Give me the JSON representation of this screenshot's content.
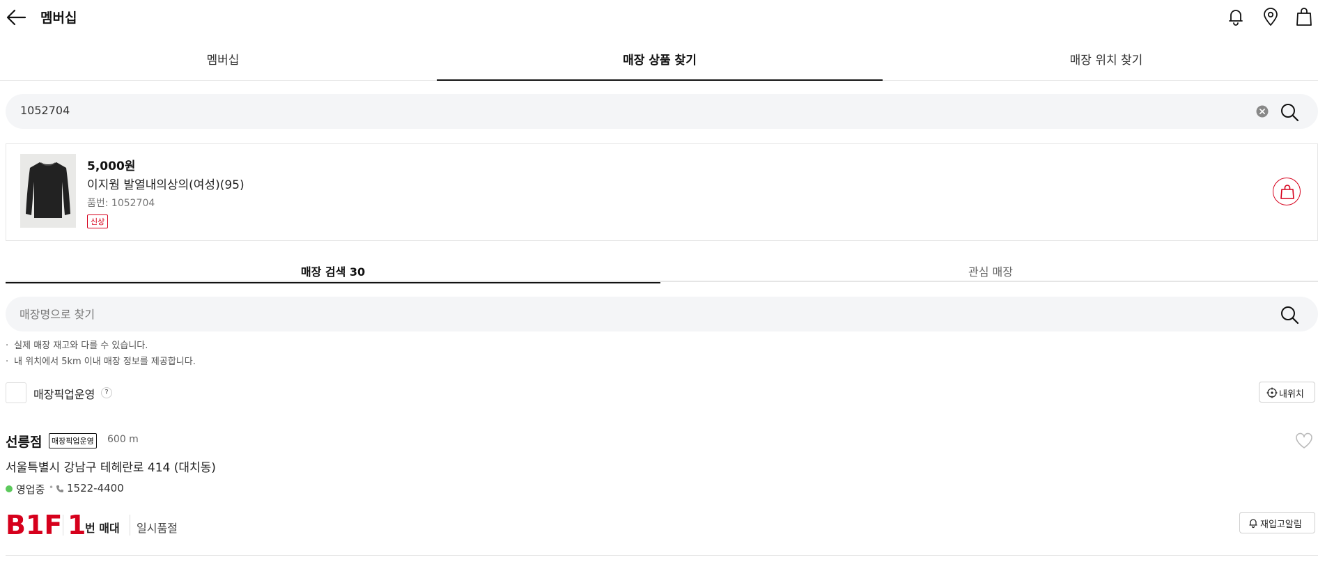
{
  "header": {
    "title": "멤버십",
    "icons": [
      "back-arrow-icon",
      "bell-icon",
      "location-pin-icon",
      "shopping-bag-icon"
    ]
  },
  "tabs": [
    {
      "label": "멤버십",
      "active": false
    },
    {
      "label": "매장 상품 찾기",
      "active": true
    },
    {
      "label": "매장 위치 찾기",
      "active": false
    }
  ],
  "search": {
    "value": "1052704"
  },
  "product": {
    "price": "5,000원",
    "name": "이지웜 발열내의상의(여성)(95)",
    "code": "품번: 1052704",
    "badge": "신상"
  },
  "subtabs": [
    {
      "label": "매장 검색 30",
      "active": true
    },
    {
      "label": "관심 매장",
      "active": false
    }
  ],
  "store_search": {
    "placeholder": "매장명으로 찾기"
  },
  "notices": [
    "실제 매장 재고와 다를 수 있습니다.",
    "내 위치에서 5km 이내 매장 정보를 제공합니다."
  ],
  "filter": {
    "pickup_label": "매장픽업운영",
    "help": "?",
    "my_location": "내위치"
  },
  "store": {
    "name": "선릉점",
    "badge": "매장픽업운영",
    "distance": "600 m",
    "address": "서울특별시 강남구 테헤란로 414 (대치동)",
    "status": "영업중",
    "separator": "•",
    "phone": "1522-4400",
    "floor": "B1F",
    "aisle_number": "1",
    "aisle_unit": "번 매대",
    "stock_status": "일시품절",
    "restock_button": "재입고알림"
  },
  "colors": {
    "accent": "#d6001c",
    "open_status": "#5cc95c",
    "search_bg": "#f4f5f7"
  }
}
